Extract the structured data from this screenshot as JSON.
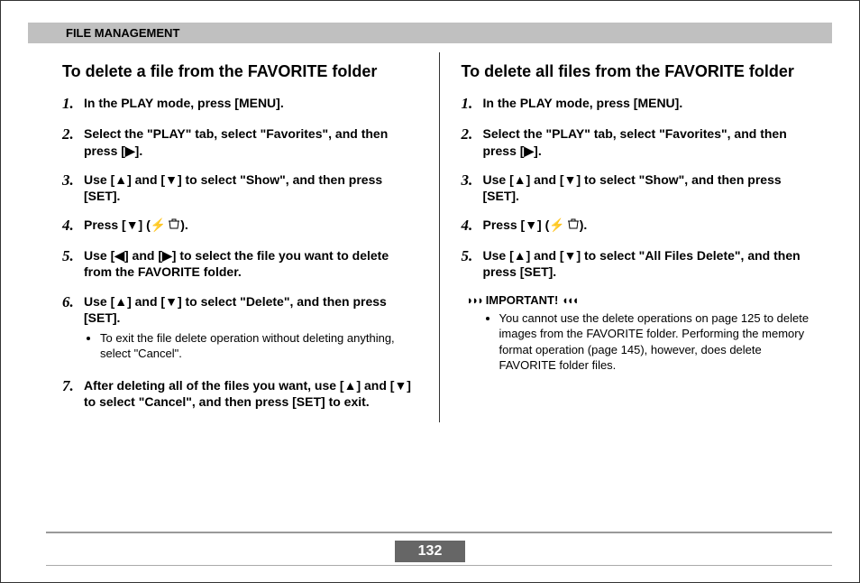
{
  "header": "FILE MANAGEMENT",
  "left": {
    "title": "To delete a file from the FAVORITE folder",
    "steps": [
      "In the PLAY mode, press [MENU].",
      "Select the \"PLAY\" tab, select \"Favorites\", and then press [▶].",
      "Use [▲] and [▼] to select \"Show\", and then press [SET].",
      "Press [▼] (",
      "Use [◀] and [▶] to select the file you want to delete from the FAVORITE folder.",
      "Use [▲] and [▼] to select \"Delete\", and then press [SET].",
      "After deleting all of the files you want, use [▲] and [▼] to select \"Cancel\", and then press [SET] to exit."
    ],
    "step4_tail": ").",
    "sub": "To exit the file delete operation without deleting anything, select \"Cancel\"."
  },
  "right": {
    "title": "To delete all files from the FAVORITE folder",
    "steps": [
      "In the PLAY mode, press [MENU].",
      "Select the \"PLAY\" tab, select \"Favorites\", and then press [▶].",
      "Use [▲] and [▼] to select \"Show\", and then press [SET].",
      "Press [▼] (",
      "Use [▲] and [▼] to select \"All Files Delete\", and then press [SET]."
    ],
    "step4_tail": ").",
    "important_label": "IMPORTANT!",
    "important_text": "You cannot use the delete operations on page 125 to delete images from the FAVORITE folder. Performing the memory format operation (page 145), however, does delete FAVORITE folder files."
  },
  "pagenum": "132"
}
